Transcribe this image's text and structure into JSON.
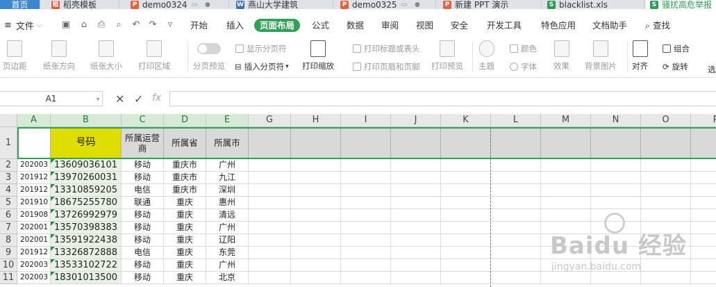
{
  "tabs": [
    {
      "label": "首页",
      "icon": "home"
    },
    {
      "label": "稻壳模板",
      "icon": "docer-icon"
    },
    {
      "label": "demo0324",
      "icon": "ppt-icon"
    },
    {
      "label": "燕山大学建筑",
      "icon": "word-icon"
    },
    {
      "label": "demo0325",
      "icon": "ppt-icon"
    },
    {
      "label": "新建 PPT 演示",
      "icon": "ppt-icon"
    },
    {
      "label": "blacklist.xls",
      "icon": "excel-icon"
    },
    {
      "label": "骚扰高危举报",
      "icon": "excel-icon"
    }
  ],
  "menu": {
    "file": "文件",
    "tabs": [
      "开始",
      "插入",
      "页面布局",
      "公式",
      "数据",
      "审阅",
      "视图",
      "安全",
      "开发工具",
      "特色应用",
      "文档助手"
    ],
    "active": "页面布局",
    "search": "查找"
  },
  "ribbon": {
    "margins": "页边距",
    "orientation": "纸张方向",
    "size": "纸张大小",
    "print_area": "打印区域",
    "page_preview": "分页预览",
    "show_breaks": "显示分页符",
    "insert_break": "插入分页符",
    "print_scale": "打印缩放",
    "print_titles": "打印标题或表头",
    "header_footer": "打印页眉和页脚",
    "print_preview": "打印预览",
    "theme": "主题",
    "colors": "颜色",
    "fonts": "字体",
    "effects": "效果",
    "bg_image": "背景图片",
    "align": "对齐",
    "group": "组合",
    "rotate": "旋转",
    "select": "选"
  },
  "formula_bar": {
    "name_box": "A1",
    "cancel": "✕",
    "confirm": "✓",
    "fx": "fx",
    "value": ""
  },
  "columns": [
    "A",
    "B",
    "C",
    "D",
    "E",
    "G",
    "H",
    "I",
    "J",
    "K",
    "L",
    "M",
    "N",
    "O",
    "P"
  ],
  "row_numbers": [
    "1",
    "2",
    "3",
    "4",
    "5",
    "6",
    "7",
    "8",
    "9",
    "10",
    "11"
  ],
  "header": {
    "a": "",
    "b": "号码",
    "c": "所属运营商",
    "d": "所属省",
    "e": "所属市"
  },
  "rows": [
    {
      "a": "202003",
      "b": "13609036101",
      "c": "移动",
      "d": "重庆市",
      "e": "广州"
    },
    {
      "a": "201912",
      "b": "13970260031",
      "c": "移动",
      "d": "重庆市",
      "e": "九江"
    },
    {
      "a": "201912",
      "b": "13310859205",
      "c": "电信",
      "d": "重庆市",
      "e": "深圳"
    },
    {
      "a": "201910",
      "b": "18675255780",
      "c": "联通",
      "d": "重庆",
      "e": "惠州"
    },
    {
      "a": "201908",
      "b": "13726992979",
      "c": "移动",
      "d": "重庆",
      "e": "清远"
    },
    {
      "a": "202001",
      "b": "13570398383",
      "c": "移动",
      "d": "重庆",
      "e": "广州"
    },
    {
      "a": "202001",
      "b": "13591922438",
      "c": "移动",
      "d": "重庆",
      "e": "辽阳"
    },
    {
      "a": "201912",
      "b": "13326872888",
      "c": "电信",
      "d": "重庆",
      "e": "东莞"
    },
    {
      "a": "202003",
      "b": "13533102722",
      "c": "移动",
      "d": "重庆",
      "e": "广州"
    },
    {
      "a": "202003",
      "b": "18301013500",
      "c": "移动",
      "d": "重庆",
      "e": "北京"
    }
  ],
  "watermark": {
    "main": "Baidu 经验",
    "sub": "jingyan.baidu.com"
  }
}
